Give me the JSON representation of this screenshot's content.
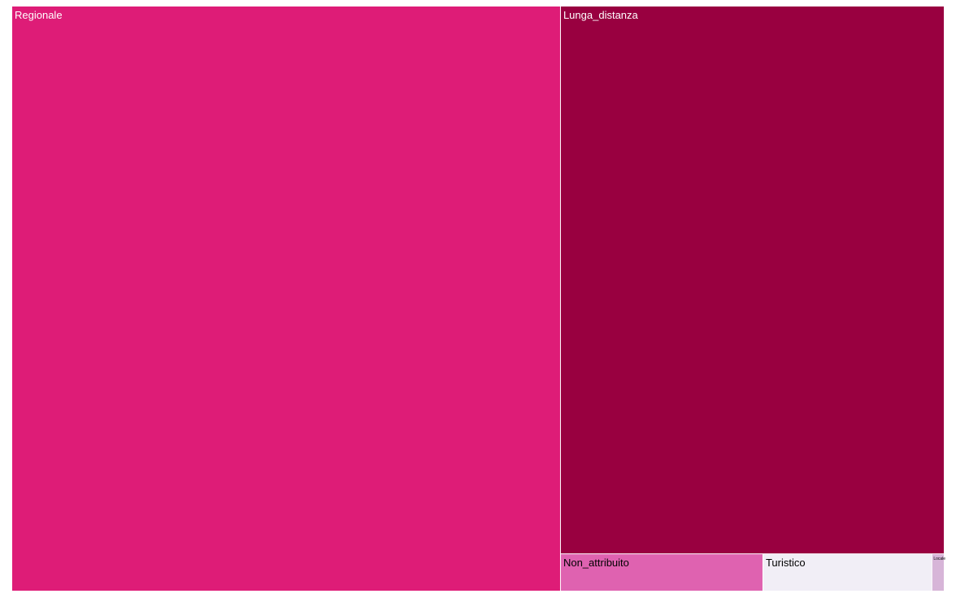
{
  "chart_data": {
    "type": "treemap",
    "items": [
      {
        "label": "Regionale",
        "value": 4880,
        "color": "#de1c77",
        "text_color": "#ffffff"
      },
      {
        "label": "Lunga_distanza",
        "value": 3200,
        "color": "#990040",
        "text_color": "#ffffff"
      },
      {
        "label": "Non_attribuito",
        "value": 115,
        "color": "#df62b0",
        "text_color": "#000000"
      },
      {
        "label": "Turistico",
        "value": 96,
        "color": "#f1eef6",
        "text_color": "#000000"
      },
      {
        "label": "Locale",
        "value": 7,
        "color": "#d7b5d8",
        "text_color": "#000000"
      }
    ]
  }
}
